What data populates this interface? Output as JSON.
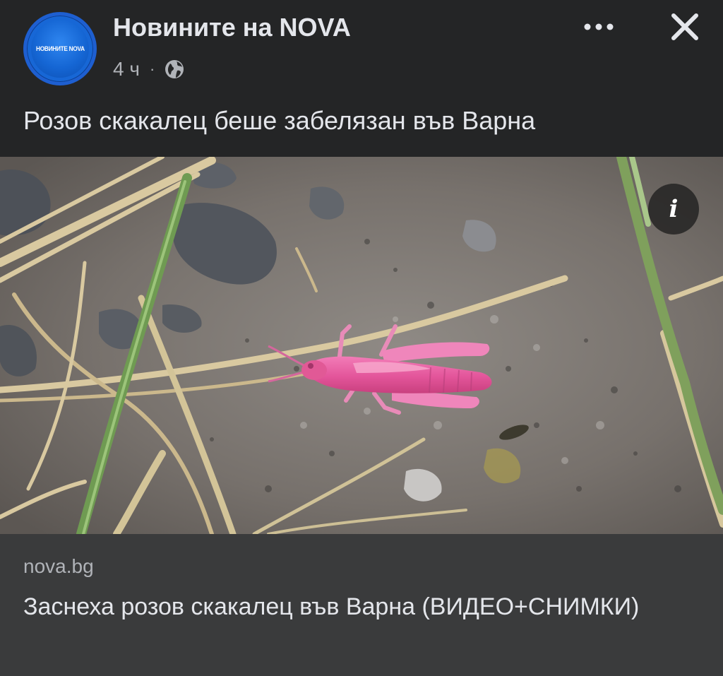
{
  "header": {
    "avatar_logo_text": "НОВИНИТЕ NOVA",
    "page_name": "Новините на NOVA",
    "time_ago": "4 ч",
    "separator": "·",
    "audience_icon": "globe-icon",
    "more_icon": "more-horizontal-icon",
    "close_icon": "close-icon"
  },
  "post": {
    "text": "Розов скакалец беше забелязан във Варна"
  },
  "photo": {
    "info_icon": "info-icon",
    "info_glyph": "i"
  },
  "link_preview": {
    "domain": "nova.bg",
    "title": "Заснеха розов скакалец във Варна (ВИДЕО+СНИМКИ)"
  },
  "colors": {
    "background": "#242526",
    "link_box": "#3a3b3c",
    "primary_text": "#e4e6eb",
    "secondary_text": "#b0b3b8",
    "avatar_blue": "#1767d6",
    "grasshopper_pink": "#e3559a"
  }
}
